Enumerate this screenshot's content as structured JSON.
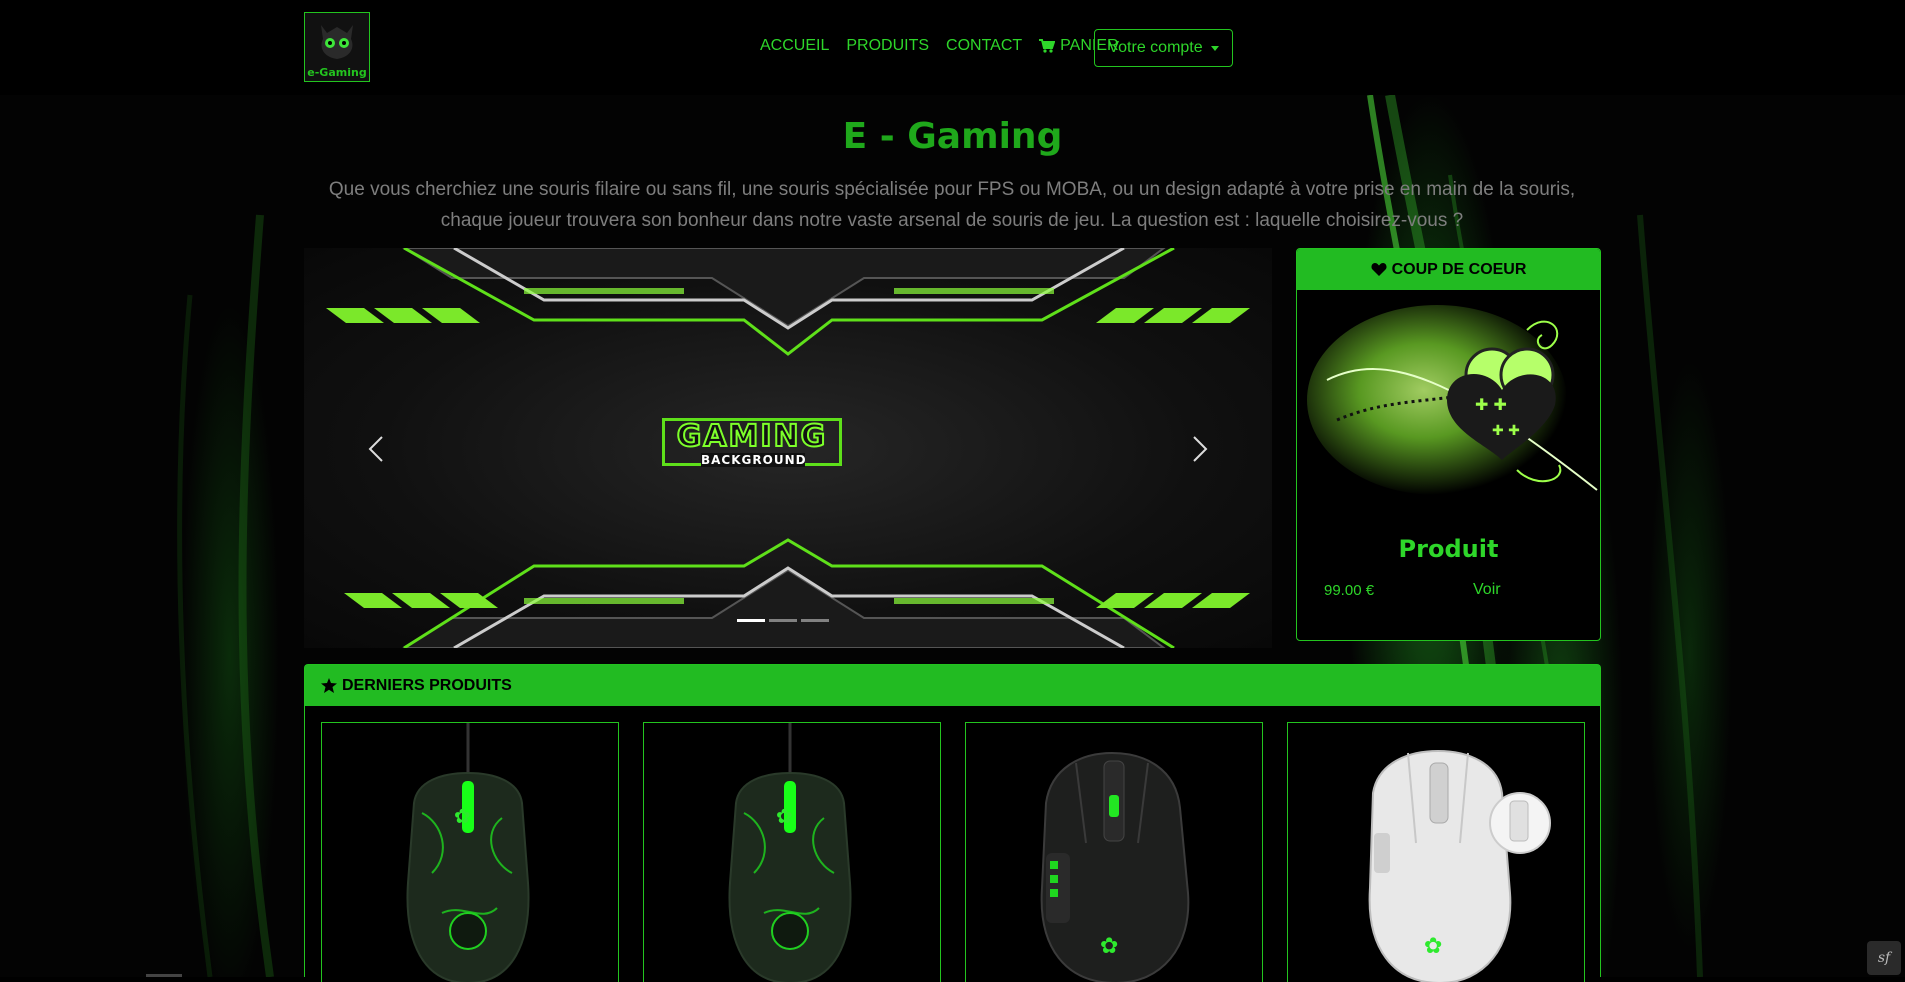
{
  "brand": {
    "logo_text": "e-Gaming",
    "accent": "#23c41f"
  },
  "nav": {
    "links": [
      "ACCUEIL",
      "PRODUITS",
      "CONTACT"
    ],
    "cart_label": "PANIER",
    "account_label": "Votre compte"
  },
  "hero": {
    "title": "E - Gaming",
    "text": "Que vous cherchiez une souris filaire ou sans fil, une souris spécialisée pour FPS ou MOBA, ou un design adapté à votre prise en main de la souris, chaque joueur trouvera son bonheur dans notre vaste arsenal de souris de jeu. La question est : laquelle choisirez-vous ?"
  },
  "carousel": {
    "slide_title": "GAMING",
    "slide_subtitle": "BACKGROUND",
    "indicator_count": 3,
    "active_index": 0
  },
  "featured": {
    "header": "COUP DE COEUR",
    "header_icon": "heart-icon",
    "product_name": "Produit",
    "price": "99.00 €",
    "link": "Voir"
  },
  "latest": {
    "header": "DERNIERS PRODUITS",
    "header_icon": "star-icon",
    "products": [
      {
        "image": "razer-deathadder-camo-mouse"
      },
      {
        "image": "razer-deathadder-camo-mouse"
      },
      {
        "image": "razer-naga-black-mouse"
      },
      {
        "image": "razer-viper-white-mouse"
      }
    ]
  },
  "footer": {
    "debug_badge": "sf"
  }
}
